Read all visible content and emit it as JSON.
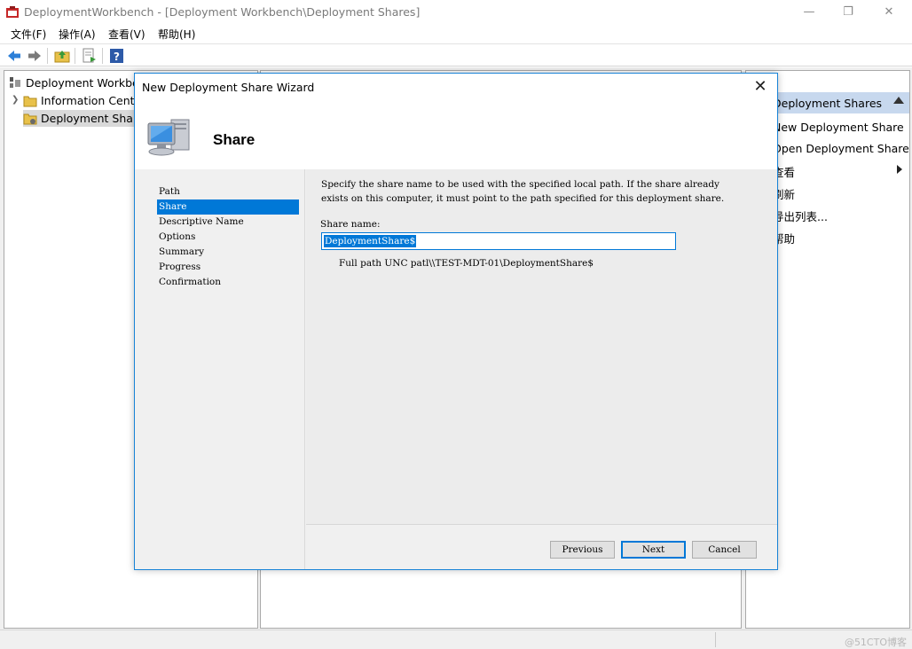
{
  "window": {
    "title": "DeploymentWorkbench - [Deployment Workbench\\Deployment Shares]",
    "minimize": "—",
    "restore": "❐",
    "close": "✕"
  },
  "menu": [
    "文件(F)",
    "操作(A)",
    "查看(V)",
    "帮助(H)"
  ],
  "tree": {
    "root": "Deployment Workbench",
    "items": [
      "Information Center",
      "Deployment Shares"
    ]
  },
  "actions": {
    "header": "Deployment Shares",
    "items": [
      "New Deployment Share",
      "Open Deployment Share",
      "查看",
      "刷新",
      "导出列表...",
      "帮助"
    ]
  },
  "dialog": {
    "title": "New Deployment Share Wizard",
    "close": "✕",
    "heading": "Share",
    "steps": [
      "Path",
      "Share",
      "Descriptive Name",
      "Options",
      "Summary",
      "Progress",
      "Confirmation"
    ],
    "description": "Specify the share name to be used with the specified local path.  If the share already exists on this computer, it must point to the path specified for this deployment share.",
    "share_label": "Share name:",
    "share_value": "DeploymentShare$",
    "unc_text": "Full path UNC patl\\\\TEST-MDT-01\\DeploymentShare$",
    "buttons": {
      "previous": "Previous",
      "next": "Next",
      "cancel": "Cancel"
    }
  },
  "watermark": "@51CTO博客",
  "colors": {
    "accent": "#0078d7",
    "dialog_border": "#1883d7",
    "actions_header": "#c7d8ee"
  }
}
